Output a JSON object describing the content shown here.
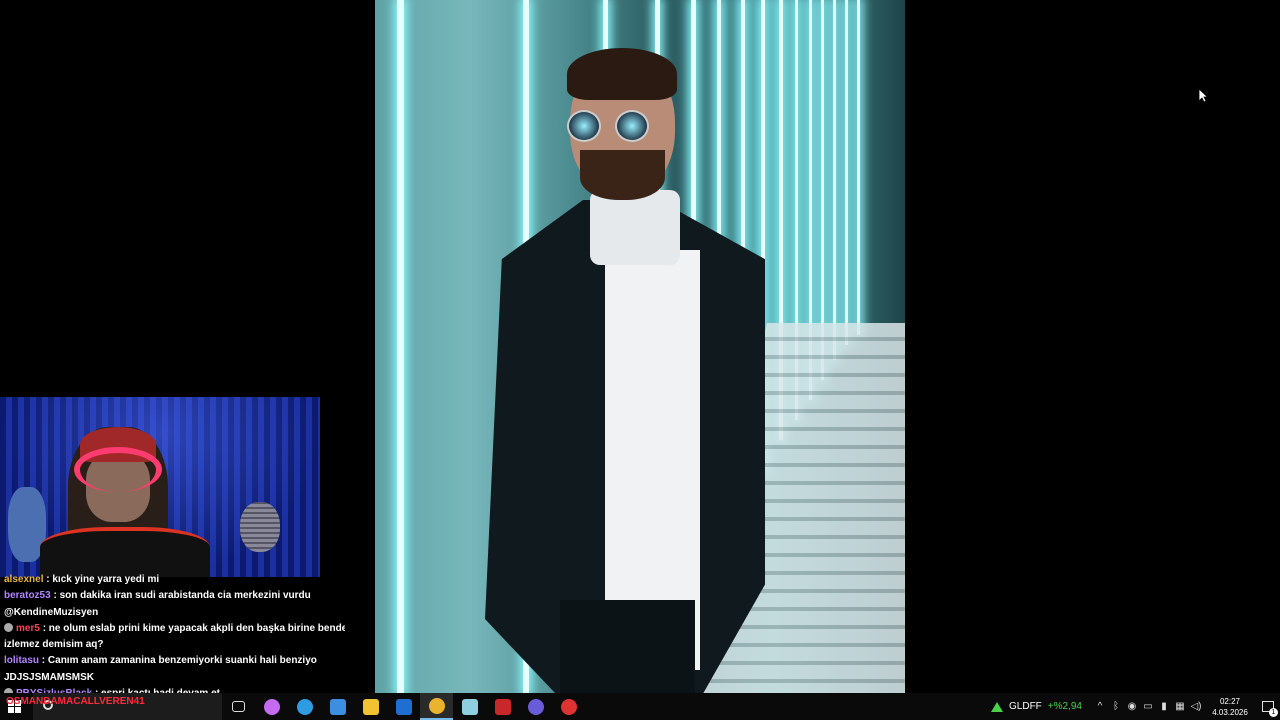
{
  "chat": {
    "messages": [
      {
        "user": "alsexnel",
        "text": ": kıck yine yarra yedi mi",
        "user_color": "#e8b447"
      },
      {
        "user": "beratoz53",
        "text": ": son dakika iran sudi arabistanda cia merkezini vurdu",
        "user_color": "#b185ff"
      },
      {
        "user": "",
        "text": "@KendineMuzisyen",
        "user_color": "#ffffff"
      },
      {
        "user": "mer5",
        "text": ": ne olum eslab prini kime yapacak akpli den başka birine bende akp",
        "user_color": "#ff4455",
        "badge": true
      },
      {
        "user": "",
        "text": "izlemez demisim aq?",
        "user_color": "#ffffff"
      },
      {
        "user": "lolitasu",
        "text": ": Canım anam zamanina benzemiyorki suanki hali benziyo",
        "user_color": "#b185ff"
      },
      {
        "user": "",
        "text": "JDJSJSMAMSMSK",
        "user_color": "#ffffff"
      },
      {
        "user": "PBYSizlusBlack",
        "text": ": espri kaçtı hadi devam et",
        "user_color": "#b185ff",
        "badge": true
      }
    ]
  },
  "overlay": {
    "name": "OSMANDAMACALLVEREN41"
  },
  "taskbar": {
    "apps": [
      {
        "name": "task-view-icon",
        "glyph": "⧉",
        "color": "#ffffff",
        "active": false
      },
      {
        "name": "copilot-icon",
        "glyph": "",
        "color": "#c56bf0",
        "active": false
      },
      {
        "name": "edge-icon",
        "glyph": "",
        "color": "#2f9be3",
        "active": false
      },
      {
        "name": "store-icon",
        "glyph": "",
        "color": "#3c8fe0",
        "active": false
      },
      {
        "name": "file-explorer-icon",
        "glyph": "",
        "color": "#f1c232",
        "active": false
      },
      {
        "name": "outlook-icon",
        "glyph": "",
        "color": "#1e6fd1",
        "active": false
      },
      {
        "name": "chrome-icon",
        "glyph": "",
        "color": "#e9b32d",
        "active": true
      },
      {
        "name": "notepad-icon",
        "glyph": "",
        "color": "#8ecfe0",
        "active": false
      },
      {
        "name": "video-editor-icon",
        "glyph": "",
        "color": "#c8282a",
        "active": false
      },
      {
        "name": "discord-icon",
        "glyph": "",
        "color": "#6a5bd8",
        "active": false
      },
      {
        "name": "obs-icon",
        "glyph": "",
        "color": "#d33",
        "active": false
      }
    ],
    "ticker": {
      "symbol": "GLDFF",
      "change": "+%2,94",
      "change_color": "#4bd04b"
    },
    "clock": {
      "time": "02:27",
      "date": "4.03.2026"
    },
    "notification_count": "1"
  }
}
